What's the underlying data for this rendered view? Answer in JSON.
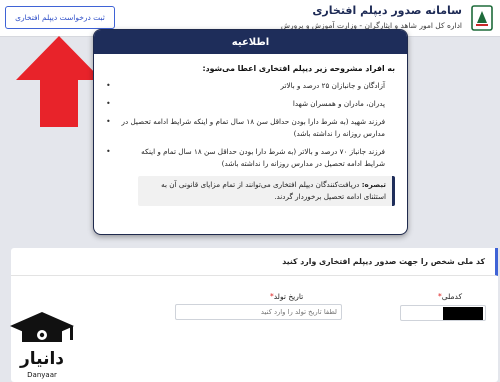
{
  "header": {
    "title": "سامانه صدور دیپلم افتخاری",
    "subtitle": "اداره کل امور شاهد و ایثارگران - وزارت آموزش و پرورش",
    "request_button": "ثبت درخواست دیپلم افتخاری"
  },
  "modal": {
    "title": "اطلاعیه",
    "heading": "به افراد مشروحه زیر دیپلم افتخاری اعطا می‌شود:",
    "items": [
      "آزادگان و جانبازان ۲۵ درصد و بالاتر",
      "پدران، مادران و همسران شهدا",
      "فرزند شهید (به شرط دارا بودن حداقل سن ۱۸ سال تمام و اینکه شرایط ادامه تحصیل در مدارس روزانه را نداشته باشد)",
      "فرزند جانباز ۷۰ درصد و بالاتر (به شرط دارا بودن حداقل سن ۱۸ سال تمام و اینکه شرایط ادامه تحصیل در مدارس روزانه را نداشته باشد)"
    ],
    "note_label": "تبصره:",
    "note_text": "دریافت‌کنندگان دیپلم افتخاری می‌توانند از تمام مزایای قانونی آن به استثنای ادامه تحصیل برخوردار گردند."
  },
  "form": {
    "title": "کد ملی شخص را جهت صدور دیپلم افتخاری وارد کنید",
    "national_code_label": "کدملی",
    "birth_date_label": "تاریخ تولد",
    "birth_date_placeholder": "لطفا تاریخ تولد را وارد کنید",
    "required_mark": "*"
  },
  "watermark": {
    "text": "دانیار",
    "latin": "Danyaar"
  },
  "colors": {
    "navy": "#1e2d5a",
    "accent_blue": "#3f63d6",
    "arrow_red": "#e8232a"
  }
}
